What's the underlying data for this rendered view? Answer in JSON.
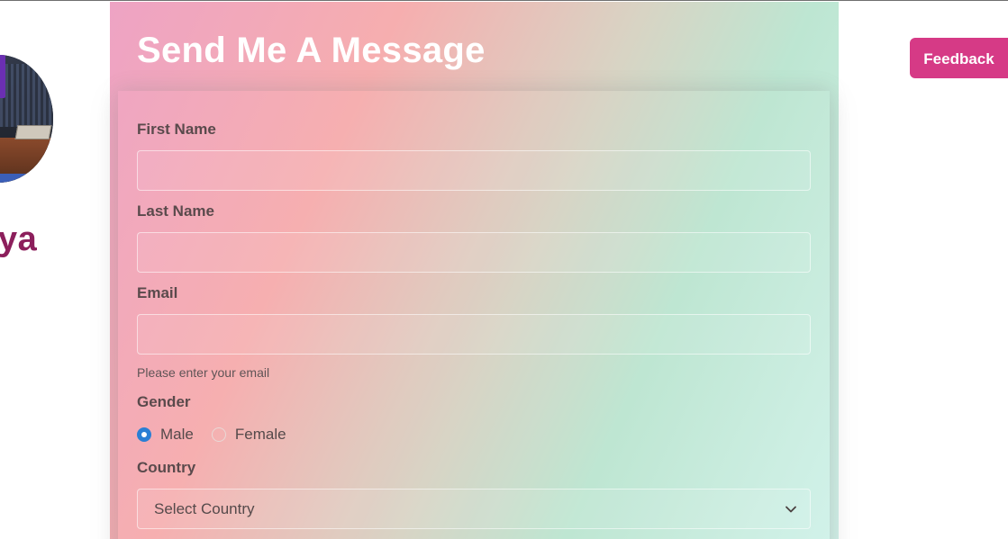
{
  "sidebar": {
    "name_fragment": "ya"
  },
  "header": {
    "feedback_label": "Feedback"
  },
  "form": {
    "title": "Send Me A Message",
    "first_name": {
      "label": "First Name",
      "value": "",
      "placeholder": ""
    },
    "last_name": {
      "label": "Last Name",
      "value": "",
      "placeholder": ""
    },
    "email": {
      "label": "Email",
      "value": "",
      "placeholder": "",
      "hint": "Please enter your email"
    },
    "gender": {
      "label": "Gender",
      "options": [
        "Male",
        "Female"
      ],
      "selected": "Male"
    },
    "country": {
      "label": "Country",
      "selected": "Select Country"
    }
  },
  "colors": {
    "accent": "#d63a86",
    "name_color": "#8c1f5c",
    "radio_checked": "#2a7fd4",
    "gradient": [
      "#eea3c4",
      "#f6aeaf",
      "#d8d4c4",
      "#bde6d2",
      "#d2f2ea"
    ]
  },
  "icons": {
    "select_chevron": "chevron-down-icon"
  }
}
